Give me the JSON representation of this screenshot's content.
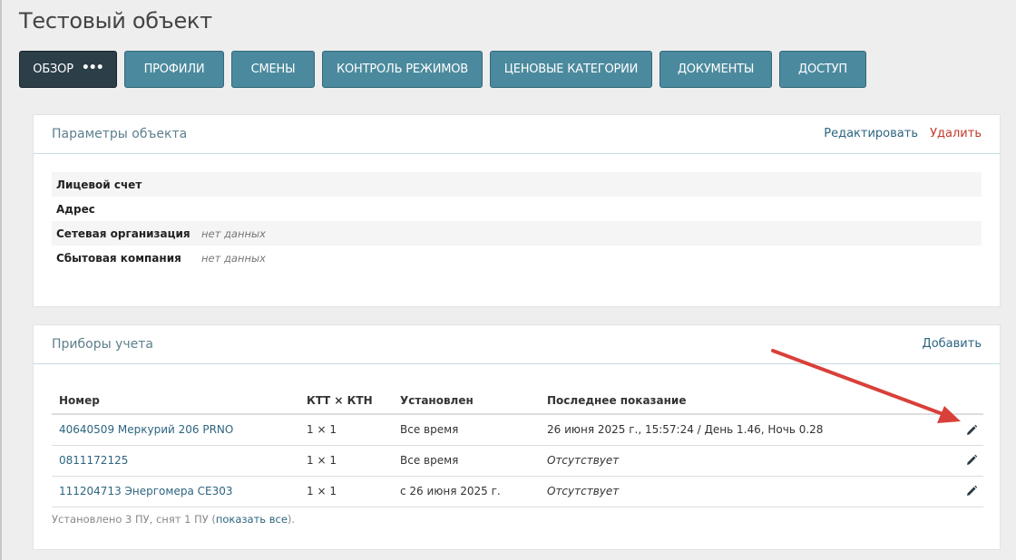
{
  "page": {
    "title": "Тестовый объект"
  },
  "tabs": [
    {
      "label": "Обзор",
      "active": true,
      "more_icon": "ellipsis-icon"
    },
    {
      "label": "Профили"
    },
    {
      "label": "Смены"
    },
    {
      "label": "Контроль режимов"
    },
    {
      "label": "Ценовые категории"
    },
    {
      "label": "Документы"
    },
    {
      "label": "Доступ"
    }
  ],
  "params_panel": {
    "title": "Параметры объекта",
    "edit_label": "Редактировать",
    "delete_label": "Удалить",
    "rows": [
      {
        "label": "Лицевой счет",
        "value": ""
      },
      {
        "label": "Адрес",
        "value": ""
      },
      {
        "label": "Сетевая организация",
        "value": "нет данных"
      },
      {
        "label": "Сбытовая компания",
        "value": "нет данных"
      }
    ]
  },
  "devices_panel": {
    "title": "Приборы учета",
    "add_label": "Добавить",
    "columns": [
      "Номер",
      "КТТ × КТН",
      "Установлен",
      "Последнее показание"
    ],
    "rows": [
      {
        "number": "40640509 Меркурий 206 PRNO",
        "ratio": "1 × 1",
        "installed": "Все время",
        "last": "26 июня 2025 г., 15:57:24 / День 1.46, Ночь 0.28",
        "last_missing": false
      },
      {
        "number": "0811172125",
        "ratio": "1 × 1",
        "installed": "Все время",
        "last": "Отсутствует",
        "last_missing": true
      },
      {
        "number": "111204713 Энергомера CE303",
        "ratio": "1 × 1",
        "installed": "с 26 июня 2025 г.",
        "last": "Отсутствует",
        "last_missing": true
      }
    ],
    "summary_prefix": "Установлено 3 ПУ, снят 1 ПУ (",
    "summary_link": "показать все",
    "summary_suffix": ")."
  },
  "colors": {
    "tab": "#4b8a9e",
    "tab_active": "#2c3e48",
    "link": "#2d6580",
    "danger": "#c0392b",
    "annotation_arrow": "#d9403a"
  }
}
